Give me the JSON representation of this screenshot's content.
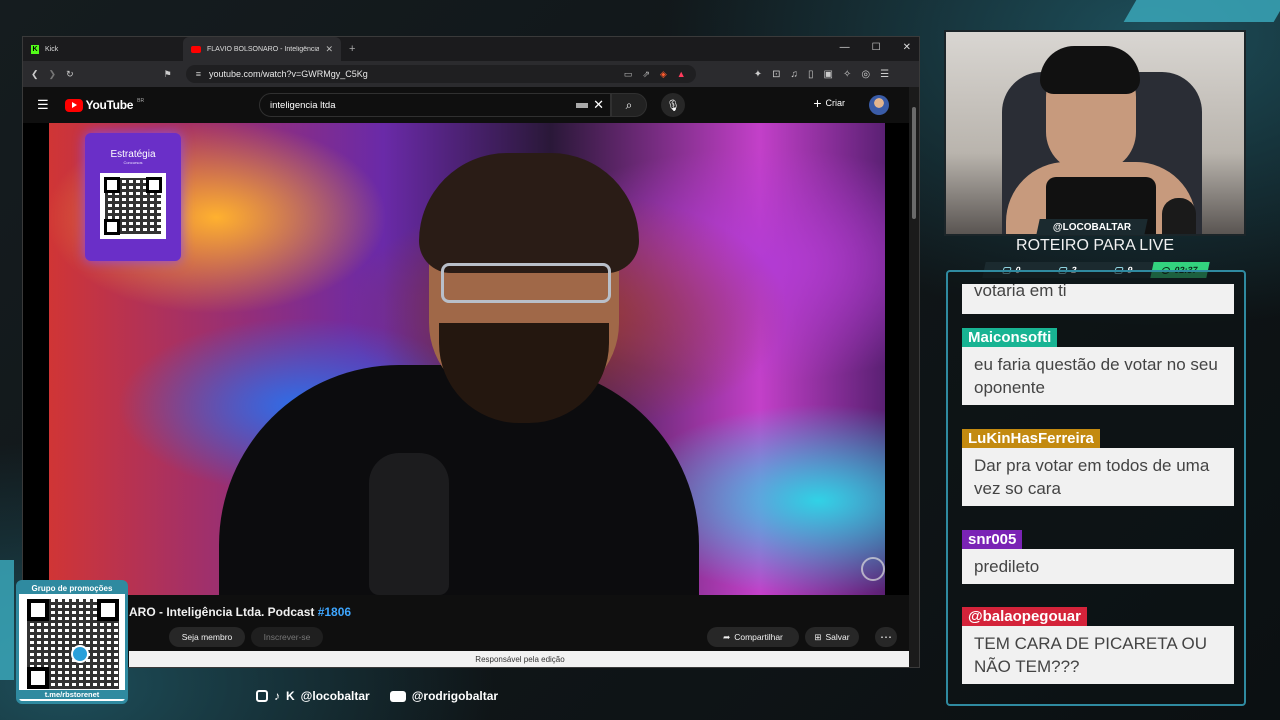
{
  "browser": {
    "tabs": [
      {
        "label": "Kick",
        "icon": "kick-icon"
      },
      {
        "label": "FLÁVIO BOLSONARO - Inteligência",
        "icon": "youtube-favicon-icon",
        "active": true
      }
    ],
    "url": "youtube.com/watch?v=GWRMgy_C5Kg"
  },
  "youtube": {
    "logo_text": "YouTube",
    "region": "BR",
    "search_value": "inteligencia ltda",
    "create_label": "Criar",
    "video_title_prefix": "ARO - Inteligência Ltda. Podcast ",
    "video_title_hash": "#1806",
    "join_label": "Seja membro",
    "subscribe_label": "Inscrever-se",
    "share_label": "Compartilhar",
    "save_label": "Salvar",
    "edit_notice": "Responsável pela edição",
    "promo": {
      "brand": "Estratégia",
      "sub": "Concursos"
    }
  },
  "stream": {
    "handle": "@LOCOBALTAR",
    "segment_title": "ROTEIRO PARA LIVE",
    "stats": {
      "messages": "0",
      "videos": "2",
      "viewers": "9",
      "time": "02:37"
    },
    "socials": {
      "handle_1": "@locobaltar",
      "handle_2": "@rodrigobaltar"
    },
    "promo_group_title": "Grupo de promoções",
    "promo_group_url": "t.me/rbstorenet"
  },
  "chat": {
    "partial_text": "votaria em ti",
    "messages": [
      {
        "user": "Maiconsofti",
        "color": "#18b493",
        "text": "eu faria questão de votar no seu oponente"
      },
      {
        "user": "LuKinHasFerreira",
        "color": "#c38a10",
        "text": "Dar pra votar em todos de uma vez so cara"
      },
      {
        "user": "snr005",
        "color": "#7a23b5",
        "text": "predileto"
      },
      {
        "user": "@balaopegouar",
        "color": "#d4233a",
        "text": "TEM CARA DE PICARETA OU NÃO TEM???"
      }
    ]
  },
  "colors": {
    "accent": "#2f8aa0",
    "youtube_red": "#ff0000",
    "timer_green": "#33d27e"
  }
}
